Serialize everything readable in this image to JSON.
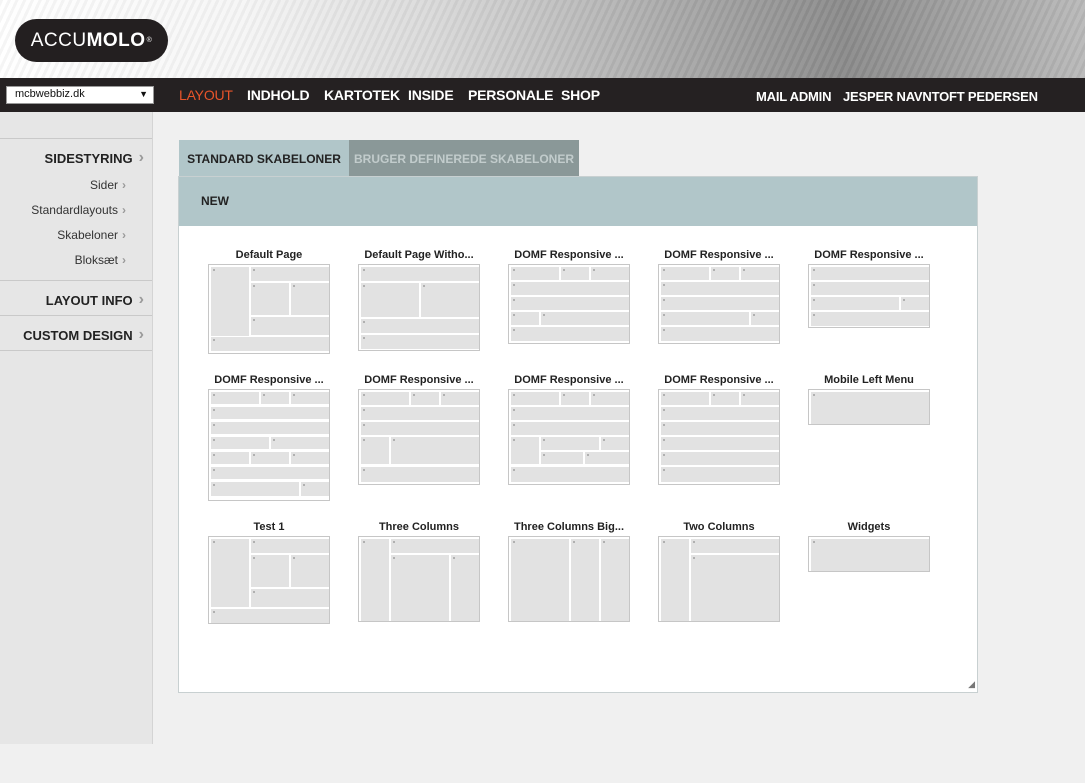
{
  "brand": {
    "logo_light": "ACCU",
    "logo_bold": "MOLO",
    "logo_mark": "®"
  },
  "site_selector": {
    "value": "mcbwebbiz.dk",
    "arrow": "▼"
  },
  "topnav": {
    "items": [
      "LAYOUT",
      "INDHOLD",
      "KARTOTEK",
      "INSIDE",
      "PERSONALE",
      "SHOP"
    ],
    "active": "LAYOUT",
    "right": [
      "MAIL ADMIN",
      "JESPER NAVNTOFT PEDERSEN"
    ]
  },
  "sidebar": {
    "sections": [
      {
        "label": "SIDESTYRING",
        "items": [
          "Sider",
          "Standardlayouts",
          "Skabeloner",
          "Bloksæt"
        ]
      },
      {
        "label": "LAYOUT INFO",
        "items": []
      },
      {
        "label": "CUSTOM DESIGN",
        "items": []
      }
    ],
    "chevron": "›"
  },
  "tabs": [
    {
      "label": "STANDARD SKABELONER",
      "active": true
    },
    {
      "label": "BRUGER DEFINEREDE SKABELONER",
      "active": false
    }
  ],
  "panel": {
    "new_label": "NEW"
  },
  "templates": [
    {
      "name": "Default Page",
      "layout": "default"
    },
    {
      "name": "Default Page Witho...",
      "layout": "default_wo"
    },
    {
      "name": "DOMF Responsive ...",
      "layout": "domf1"
    },
    {
      "name": "DOMF Responsive ...",
      "layout": "domf2"
    },
    {
      "name": "DOMF Responsive ...",
      "layout": "domf3"
    },
    {
      "name": "DOMF Responsive ...",
      "layout": "domf4"
    },
    {
      "name": "DOMF Responsive ...",
      "layout": "domf5"
    },
    {
      "name": "DOMF Responsive ...",
      "layout": "domf6"
    },
    {
      "name": "DOMF Responsive ...",
      "layout": "domf7"
    },
    {
      "name": "Mobile Left Menu",
      "layout": "single"
    },
    {
      "name": "Test 1",
      "layout": "test1"
    },
    {
      "name": "Three Columns",
      "layout": "three_cols"
    },
    {
      "name": "Three Columns Big...",
      "layout": "three_big"
    },
    {
      "name": "Two Columns",
      "layout": "two_cols"
    },
    {
      "name": "Widgets",
      "layout": "single"
    }
  ],
  "colors": {
    "accent": "#e8542a",
    "nav_bg": "#252122",
    "tab_active": "#b1c6c9",
    "tab_inactive": "#8a9898"
  }
}
